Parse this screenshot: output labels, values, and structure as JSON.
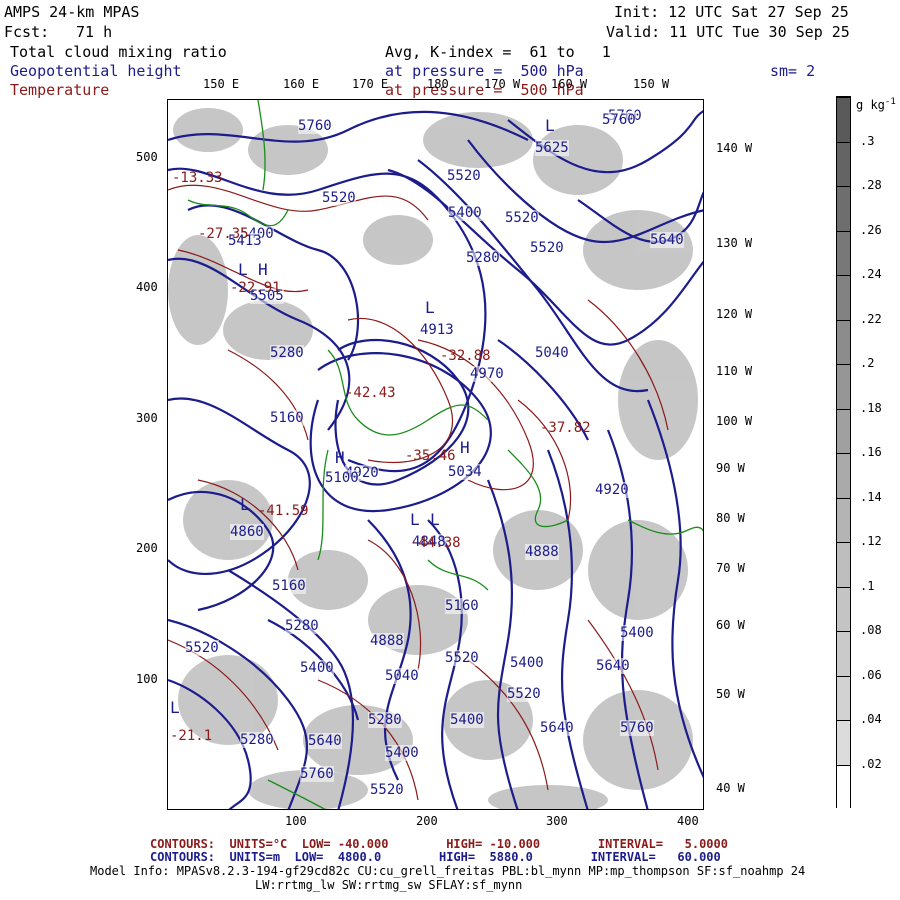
{
  "header": {
    "model": "AMPS 24-km MPAS",
    "fcst_label": "Fcst:",
    "fcst_value": "71 h",
    "init": "Init: 12 UTC Sat 27 Sep 25",
    "valid": "Valid: 11 UTC Tue 30 Sep 25",
    "field1": "Total cloud mixing ratio",
    "field2": "Geopotential height",
    "field3": "Temperature",
    "avg": "Avg, K-index =  61 to   1",
    "pressure1": "at pressure =  500 hPa",
    "pressure2": "at pressure =  500 hPa",
    "smooth": "sm= 2"
  },
  "axes": {
    "x_ticks": [
      "100",
      "200",
      "300",
      "400"
    ],
    "y_ticks": [
      "100",
      "200",
      "300",
      "400",
      "500"
    ],
    "top_lon": [
      "150 E",
      "160 E",
      "170 E",
      "180",
      "170 W",
      "160 W",
      "150 W"
    ],
    "right_lon": [
      "140 W",
      "130 W",
      "120 W",
      "110 W",
      "100 W",
      "90 W",
      "80 W",
      "70 W",
      "60 W",
      "50 W",
      "40 W"
    ]
  },
  "colorbar": {
    "unit": "g kg",
    "unit_sup": "-1",
    "labels": [
      ".3",
      ".28",
      ".26",
      ".24",
      ".22",
      ".2",
      ".18",
      ".16",
      ".14",
      ".12",
      ".1",
      ".08",
      ".06",
      ".04",
      ".02"
    ],
    "colors": [
      "#5a5a5a",
      "#646464",
      "#6e6e6e",
      "#787878",
      "#828282",
      "#8c8c8c",
      "#969696",
      "#a0a0a0",
      "#aaaaaa",
      "#b4b4b4",
      "#bebebe",
      "#c4c4c4",
      "#cacaca",
      "#d2d2d2",
      "#dcdcdc",
      "#ffffff"
    ]
  },
  "map_labels": {
    "heights": [
      "5760",
      "5625",
      "5760",
      "5520",
      "5520",
      "5400",
      "5520",
      "5520",
      "5280",
      "5640",
      "5400",
      "5413",
      "5505",
      "5280",
      "5040",
      "4913",
      "4970",
      "5160",
      "4920",
      "5100",
      "5034",
      "4860",
      "4920",
      "4888",
      "5160",
      "4848",
      "5160",
      "5280",
      "4888",
      "5520",
      "5400",
      "5040",
      "5280",
      "5400",
      "5640",
      "5280",
      "5400",
      "5520",
      "5640",
      "5760",
      "5400",
      "5760",
      "5520",
      "5640",
      "5520",
      "5400",
      "5760"
    ],
    "temps": [
      "-13.33",
      "-27.35",
      "-22.91",
      "-42.43",
      "-32.88",
      "-35.46",
      "-41.59",
      "-37.82",
      "-44.38",
      "-21.1"
    ],
    "highs_lows": [
      "H",
      "L",
      "L",
      "L",
      "H",
      "H",
      "L",
      "L",
      "L",
      "L"
    ]
  },
  "footer": {
    "line1": "CONTOURS:  UNITS=°C  LOW= -40.000        HIGH= -10.000        INTERVAL=   5.0000",
    "line2": "CONTOURS:  UNITS=m  LOW=  4800.0        HIGH=  5880.0        INTERVAL=   60.000",
    "line3": "Model Info: MPASv8.2.3-194-gf29cd82c CU:cu_grell_freitas PBL:bl_mynn MP:mp_thompson SF:sf_noahmp 24",
    "line4": "LW:rrtmg_lw SW:rrtmg_sw SFLAY:sf_mynn"
  },
  "colors": {
    "height_contour": "#1c1c8c",
    "temp_contour": "#8b1a1a",
    "coastline": "#1a8c1a"
  }
}
